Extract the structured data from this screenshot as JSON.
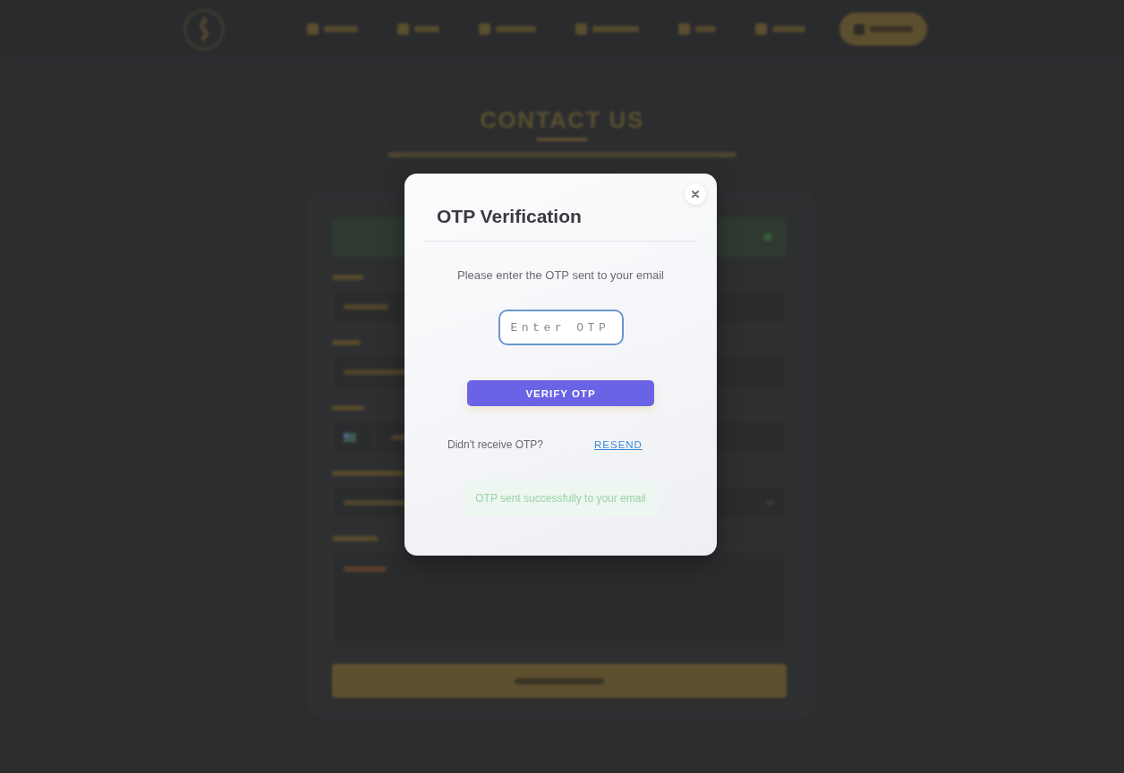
{
  "contact_section": {
    "heading": "CONTACT US"
  },
  "otp_dialog": {
    "title": "OTP Verification",
    "instruction": "Please enter the OTP sent to your email",
    "otp_field": {
      "placeholder": "Enter OTP"
    },
    "verify_button": {
      "label": "VERIFY OTP"
    },
    "resend_prompt": "Didn't receive OTP?",
    "resend_link": {
      "label": "RESEND"
    },
    "status_message": "OTP sent successfully to your email"
  }
}
